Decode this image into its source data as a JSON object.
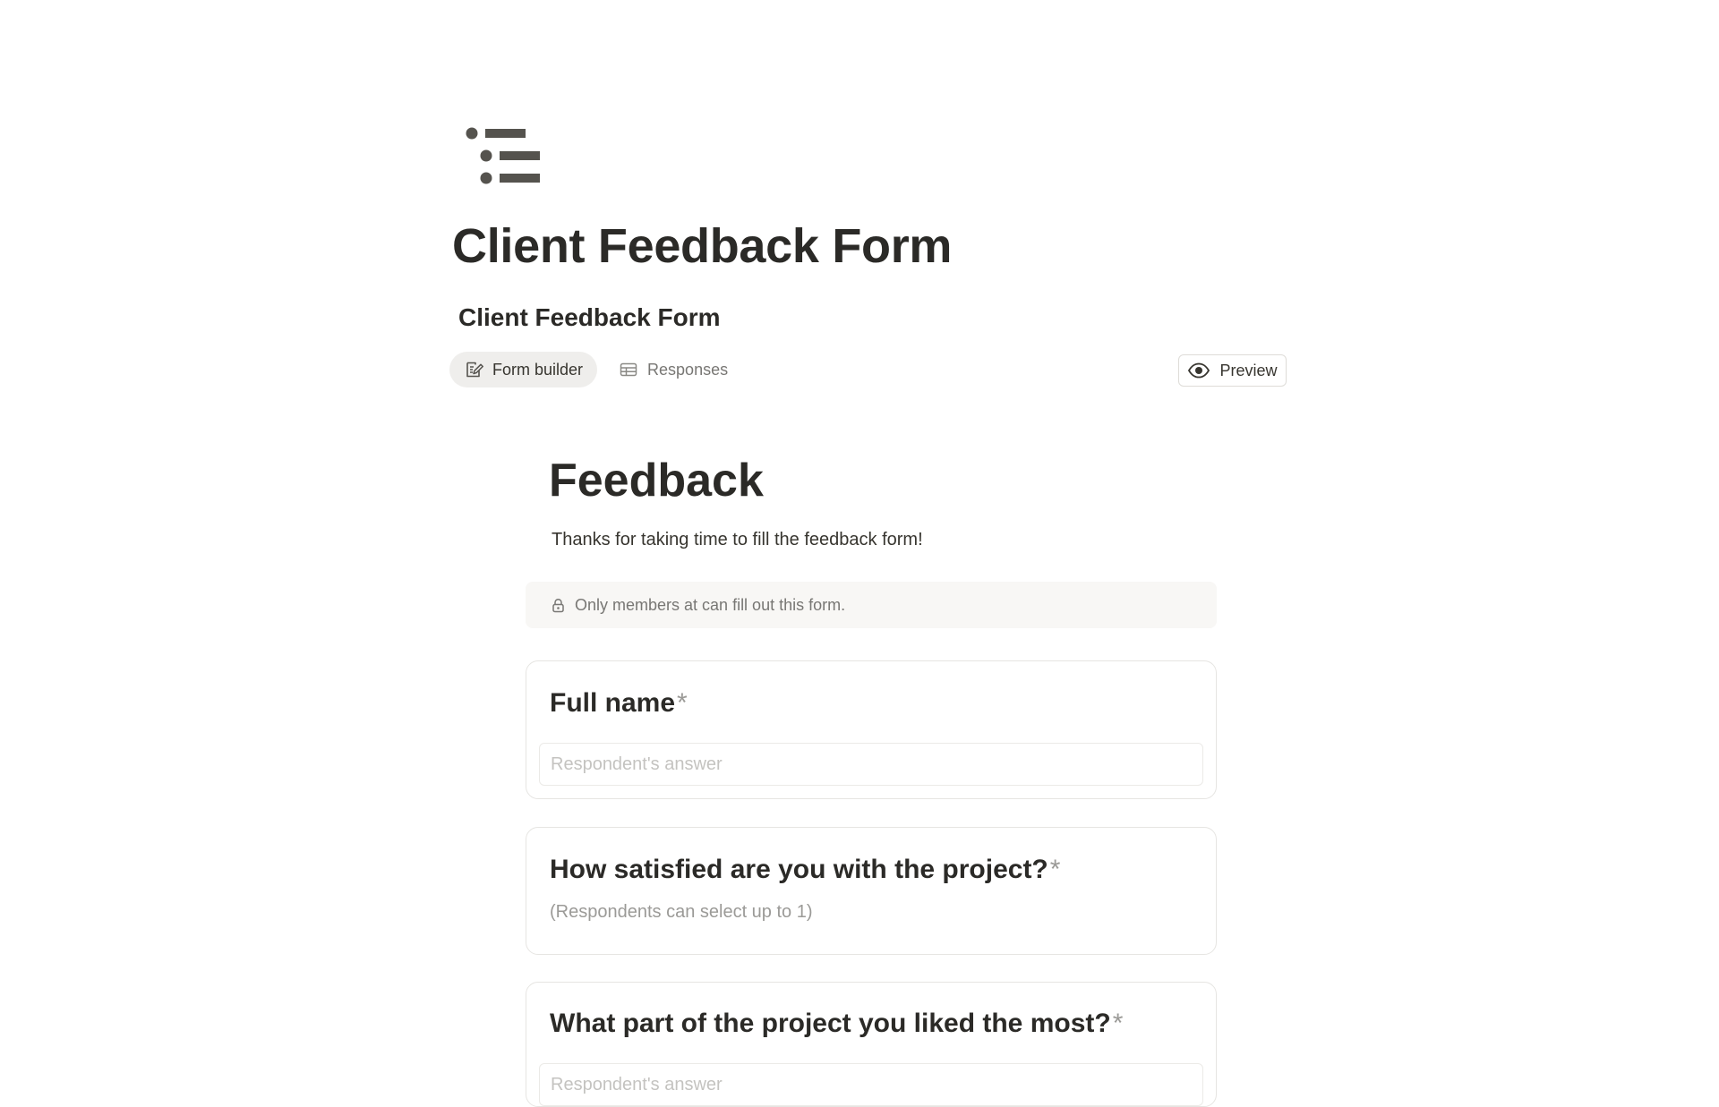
{
  "page": {
    "icon": "bulleted-list-icon",
    "title": "Client Feedback Form"
  },
  "database": {
    "title": "Client Feedback Form"
  },
  "tabs": [
    {
      "label": "Form builder",
      "icon": "edit-icon",
      "active": true
    },
    {
      "label": "Responses",
      "icon": "table-icon",
      "active": false
    }
  ],
  "preview": {
    "label": "Preview",
    "icon": "eye-icon"
  },
  "form": {
    "title": "Feedback",
    "description": "Thanks for taking time to fill the feedback form!",
    "notice": "Only members at can fill out this form.",
    "questions": [
      {
        "label": "Full name",
        "required_mark": "*",
        "placeholder": "Respondent's answer"
      },
      {
        "label": "How satisfied are you with the project?",
        "required_mark": "*",
        "hint": "(Respondents can select up to 1)"
      },
      {
        "label": "What part of the project you liked the most?",
        "required_mark": "*",
        "placeholder": "Respondent's answer"
      }
    ]
  },
  "colors": {
    "text": "#37352f",
    "heading": "#2b2a27",
    "muted": "#787774",
    "active_tab_bg": "#efeeec",
    "notice_bg": "#f8f7f5"
  }
}
